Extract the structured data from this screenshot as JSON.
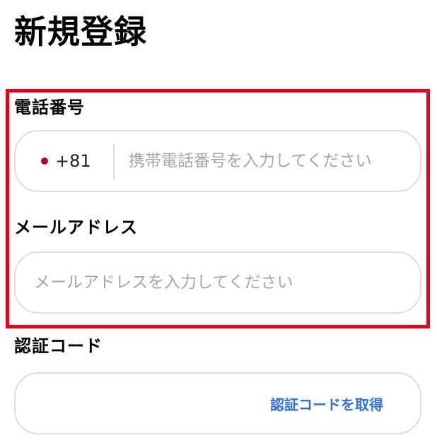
{
  "page": {
    "title": "新規登録"
  },
  "phone": {
    "label": "電話番号",
    "country_code": "+81",
    "flag_color": "#bc002d",
    "placeholder": "携帯電話番号を入力してください",
    "value": ""
  },
  "email": {
    "label": "メールアドレス",
    "placeholder": "メールアドレスを入力してください",
    "value": ""
  },
  "verification": {
    "label": "認証コード",
    "value": "",
    "get_code_button": "認証コードを取得"
  },
  "colors": {
    "highlight": "#e8001b",
    "link": "#2f6fe0",
    "placeholder": "#a6a6a6",
    "field_border": "#dedede"
  }
}
